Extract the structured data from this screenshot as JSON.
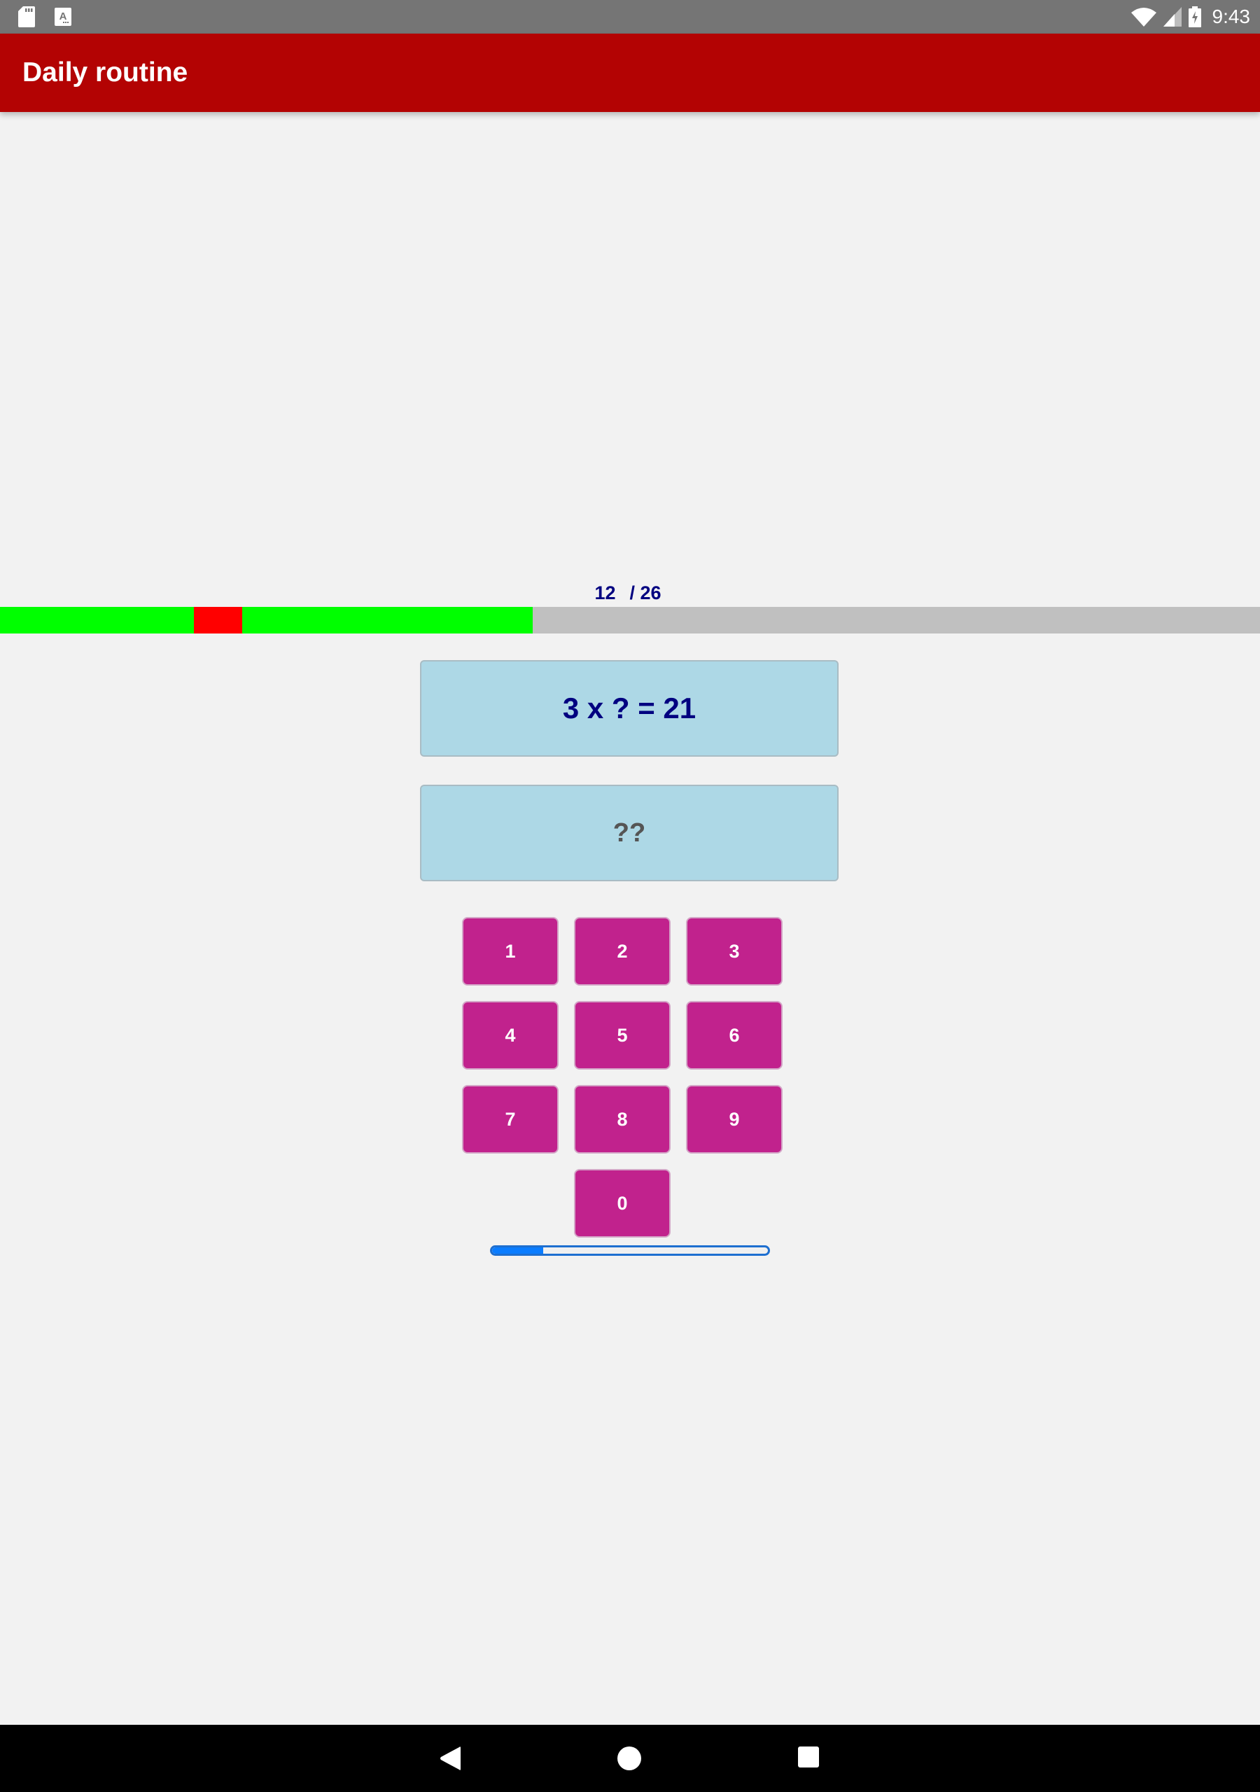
{
  "status_bar": {
    "left_icons": [
      "sd-card-icon",
      "keyboard-a-icon"
    ],
    "right_icons": [
      "wifi-icon",
      "cell-signal-icon",
      "battery-charging-icon"
    ],
    "time": "9:43"
  },
  "app_bar": {
    "title": "Daily routine"
  },
  "quiz": {
    "current": "12",
    "total": "/ 26",
    "total_questions": 26,
    "results": [
      "correct",
      "correct",
      "correct",
      "correct",
      "wrong",
      "correct",
      "correct",
      "correct",
      "correct",
      "correct",
      "correct"
    ],
    "colors": {
      "correct": "#00ff00",
      "wrong": "#ff0000",
      "pending": "#c0c0c0"
    },
    "question": "3 x ? = 21",
    "answer_placeholder": "??"
  },
  "keypad": {
    "keys": [
      "1",
      "2",
      "3",
      "4",
      "5",
      "6",
      "7",
      "8",
      "9",
      "0"
    ],
    "color": "#c1228d"
  },
  "timer": {
    "fraction_remaining": 0.185,
    "color": "#0a7cff"
  },
  "nav_bar": {
    "buttons": [
      "back-icon",
      "home-icon",
      "recents-icon"
    ]
  }
}
